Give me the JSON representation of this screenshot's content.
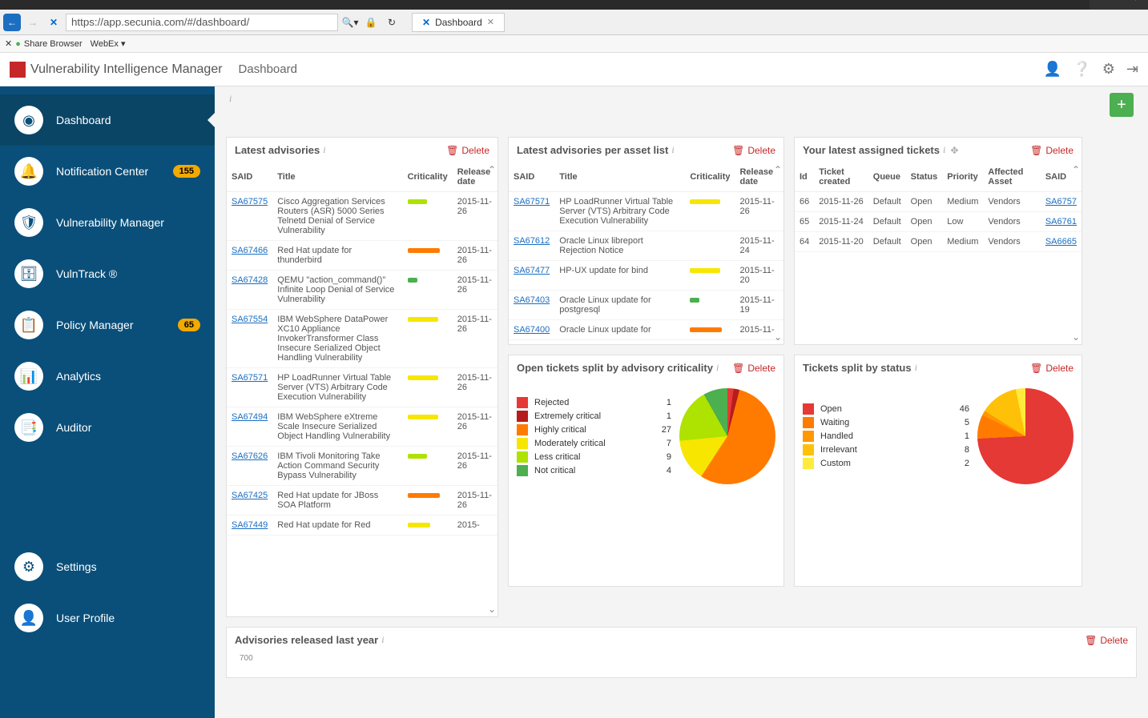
{
  "browser": {
    "url": "https://app.secunia.com/#/dashboard/",
    "tab": "Dashboard",
    "toolbar": {
      "share": "Share Browser",
      "webex": "WebEx ▾"
    }
  },
  "app": {
    "title": "Vulnerability Intelligence Manager",
    "breadcrumb": "Dashboard"
  },
  "sidebar": {
    "items": [
      {
        "label": "Dashboard",
        "icon": "◉",
        "active": true
      },
      {
        "label": "Notification Center",
        "icon": "🔔",
        "badge": "155"
      },
      {
        "label": "Vulnerability Manager",
        "icon": "🛡"
      },
      {
        "label": "VulnTrack ®",
        "icon": "🗄"
      },
      {
        "label": "Policy Manager",
        "icon": "📋",
        "badge": "65"
      },
      {
        "label": "Analytics",
        "icon": "📊"
      },
      {
        "label": "Auditor",
        "icon": "📑"
      }
    ],
    "footer": [
      {
        "label": "Settings",
        "icon": "⚙"
      },
      {
        "label": "User Profile",
        "icon": "👤"
      }
    ]
  },
  "widgets": {
    "delete_label": "Delete",
    "latest_advisories": {
      "title": "Latest advisories",
      "cols": [
        "SAID",
        "Title",
        "Criticality",
        "Release date"
      ],
      "rows": [
        {
          "said": "SA67575",
          "title": "Cisco Aggregation Services Routers (ASR) 5000 Series Telnetd Denial of Service Vulnerability",
          "crit": "lime",
          "date": "2015-11-26"
        },
        {
          "said": "SA67466",
          "title": "Red Hat update for thunderbird",
          "crit": "orange",
          "date": "2015-11-26"
        },
        {
          "said": "SA67428",
          "title": "QEMU \"action_command()\" Infinite Loop Denial of Service Vulnerability",
          "crit": "green-sm",
          "date": "2015-11-26"
        },
        {
          "said": "SA67554",
          "title": "IBM WebSphere DataPower XC10 Appliance InvokerTransformer Class Insecure Serialized Object Handling Vulnerability",
          "crit": "yellow-long",
          "date": "2015-11-26"
        },
        {
          "said": "SA67571",
          "title": "HP LoadRunner Virtual Table Server (VTS) Arbitrary Code Execution Vulnerability",
          "crit": "yellow-long",
          "date": "2015-11-26"
        },
        {
          "said": "SA67494",
          "title": "IBM WebSphere eXtreme Scale Insecure Serialized Object Handling Vulnerability",
          "crit": "yellow-long",
          "date": "2015-11-26"
        },
        {
          "said": "SA67626",
          "title": "IBM Tivoli Monitoring Take Action Command Security Bypass Vulnerability",
          "crit": "lime",
          "date": "2015-11-26"
        },
        {
          "said": "SA67425",
          "title": "Red Hat update for JBoss SOA Platform",
          "crit": "orange",
          "date": "2015-11-26"
        },
        {
          "said": "SA67449",
          "title": "Red Hat update for Red",
          "crit": "yellow",
          "date": "2015-"
        }
      ]
    },
    "latest_per_asset": {
      "title": "Latest advisories per asset list",
      "cols": [
        "SAID",
        "Title",
        "Criticality",
        "Release date"
      ],
      "rows": [
        {
          "said": "SA67571",
          "title": "HP LoadRunner Virtual Table Server (VTS) Arbitrary Code Execution Vulnerability",
          "crit": "yellow-long",
          "date": "2015-11-26"
        },
        {
          "said": "SA67612",
          "title": "Oracle Linux libreport Rejection Notice",
          "crit": "",
          "date": "2015-11-24"
        },
        {
          "said": "SA67477",
          "title": "HP-UX update for bind",
          "crit": "yellow-long",
          "date": "2015-11-20"
        },
        {
          "said": "SA67403",
          "title": "Oracle Linux update for postgresql",
          "crit": "green-sm",
          "date": "2015-11-19"
        },
        {
          "said": "SA67400",
          "title": "Oracle Linux update for",
          "crit": "orange",
          "date": "2015-11-"
        }
      ]
    },
    "assigned_tickets": {
      "title": "Your latest assigned tickets",
      "cols": [
        "Id",
        "Ticket created",
        "Queue",
        "Status",
        "Priority",
        "Affected Asset",
        "SAID"
      ],
      "rows": [
        {
          "id": "66",
          "created": "2015-11-26",
          "queue": "Default",
          "status": "Open",
          "priority": "Medium",
          "asset": "Vendors",
          "said": "SA6757"
        },
        {
          "id": "65",
          "created": "2015-11-24",
          "queue": "Default",
          "status": "Open",
          "priority": "Low",
          "asset": "Vendors",
          "said": "SA6761"
        },
        {
          "id": "64",
          "created": "2015-11-20",
          "queue": "Default",
          "status": "Open",
          "priority": "Medium",
          "asset": "Vendors",
          "said": "SA6665"
        }
      ]
    },
    "open_by_crit": {
      "title": "Open tickets split by advisory criticality"
    },
    "by_status": {
      "title": "Tickets split by status"
    },
    "released_last_year": {
      "title": "Advisories released last year",
      "ytick": "700"
    }
  },
  "chart_data": [
    {
      "type": "pie",
      "title": "Open tickets split by advisory criticality",
      "categories": [
        "Rejected",
        "Extremely critical",
        "Highly critical",
        "Moderately critical",
        "Less critical",
        "Not critical"
      ],
      "values": [
        1,
        1,
        27,
        7,
        9,
        4
      ],
      "colors": [
        "#e53935",
        "#b71c1c",
        "#ff7b00",
        "#f7e600",
        "#aee200",
        "#4caf50"
      ]
    },
    {
      "type": "pie",
      "title": "Tickets split by status",
      "categories": [
        "Open",
        "Waiting",
        "Handled",
        "Irrelevant",
        "Custom"
      ],
      "values": [
        46,
        5,
        1,
        8,
        2
      ],
      "colors": [
        "#e53935",
        "#ff7b00",
        "#ff9800",
        "#ffc107",
        "#ffeb3b"
      ]
    }
  ]
}
